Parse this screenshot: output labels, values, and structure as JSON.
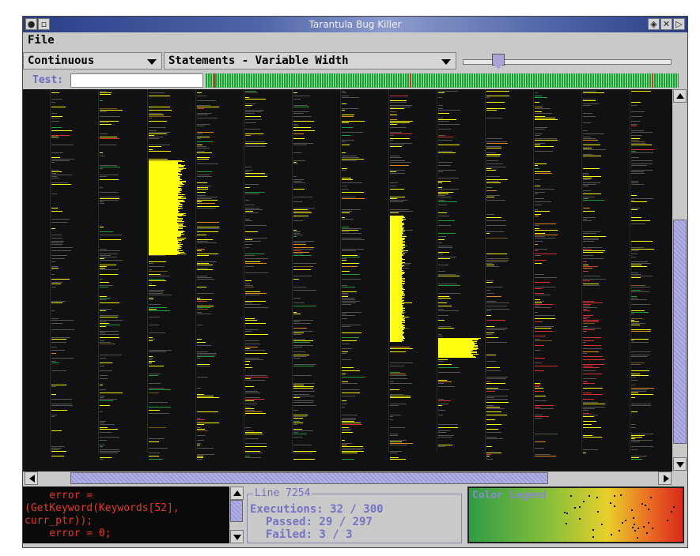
{
  "window": {
    "title": "Tarantula Bug Killer",
    "title_buttons_left": [
      "menu-icon",
      "minimize-icon"
    ],
    "title_buttons_right": [
      "shade-icon",
      "close-icon",
      "arrow-right-icon"
    ]
  },
  "menu": {
    "file": "File"
  },
  "controls": {
    "mode": "Continuous",
    "view": "Statements - Variable Width",
    "slider_value_fraction": 0.15
  },
  "test": {
    "label": "Test:",
    "value": ""
  },
  "colors": {
    "pass": "#1f9e3a",
    "fail": "#d03030",
    "suspicious": "#ffff00",
    "background": "#111111",
    "unexecuted": "#555555"
  },
  "source": {
    "lines": [
      "    error =",
      "(GetKeyword(Keywords[52],",
      "curr_ptr));",
      "    error = 0;"
    ]
  },
  "info": {
    "title": "Line 7254",
    "executions": "Executions: 32 / 300",
    "passed": "Passed: 29 / 297",
    "failed": "Failed: 3 / 3"
  },
  "legend": {
    "title": "Color Legend"
  }
}
